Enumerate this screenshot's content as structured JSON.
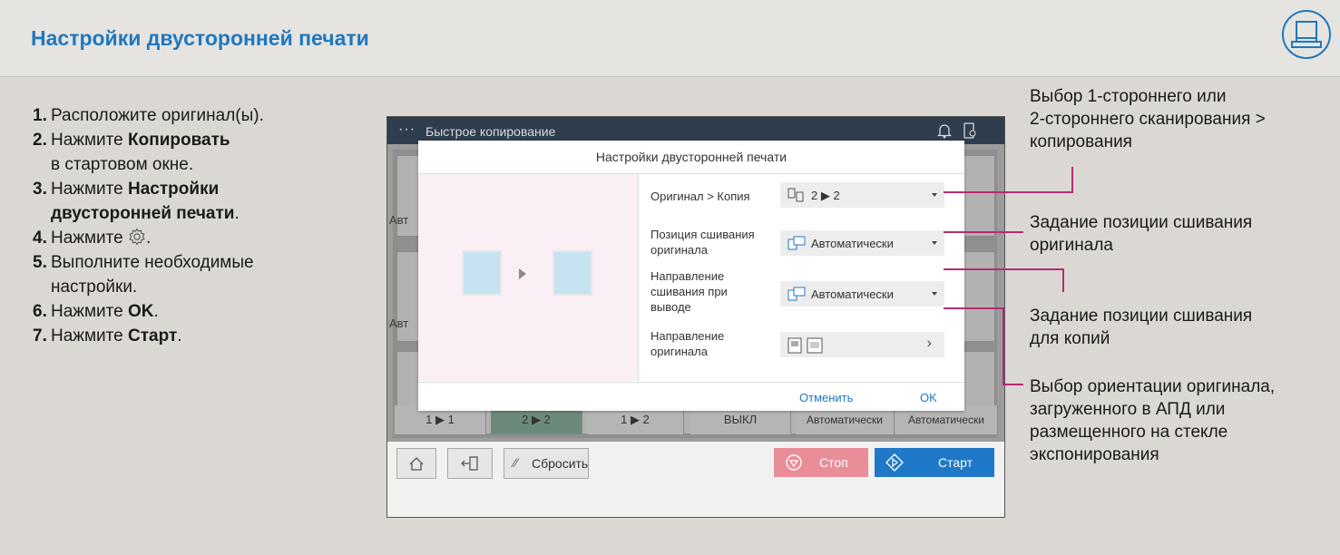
{
  "header": {
    "title": "Настройки двусторонней печати",
    "icon": "copier-device-icon"
  },
  "steps": [
    {
      "num": "1.",
      "text": "Расположите оригинал(ы)."
    },
    {
      "num": "2.",
      "pre": "Нажмите ",
      "bold": "Копировать",
      "line2": "в стартовом окне."
    },
    {
      "num": "3.",
      "pre": "Нажмите ",
      "bold": "Настройки",
      "bold2": "двусторонней печати",
      "post": "."
    },
    {
      "num": "4.",
      "pre": "Нажмите ",
      "post": "."
    },
    {
      "num": "5.",
      "text": "Выполните необходимые",
      "line2": "настройки."
    },
    {
      "num": "6.",
      "pre": "Нажмите ",
      "bold": "OK",
      "post": "."
    },
    {
      "num": "7.",
      "pre": "Нажмите ",
      "bold": "Старт",
      "post": "."
    }
  ],
  "screen": {
    "app_name": "Быстрое копирование",
    "bg_labels": [
      "Авт",
      "Авт"
    ],
    "bg_row": [
      "1 ▶ 1",
      "2 ▶ 2",
      "1 ▶ 2",
      "ВЫКЛ",
      "Автоматически",
      "Автоматически"
    ],
    "dialog": {
      "title": "Настройки двусторонней печати",
      "rows": [
        {
          "label": "Оригинал > Копия",
          "value": "2 ▶ 2"
        },
        {
          "label1": "Позиция сшивания",
          "label2": "оригинала",
          "value": "Автоматически"
        },
        {
          "label1": "Направление",
          "label2": "сшивания при",
          "label3": "выводе",
          "value": "Автоматически"
        },
        {
          "label1": "Направление",
          "label2": "оригинала",
          "chevron": "›"
        }
      ],
      "cancel": "Отменить",
      "ok": "OK"
    },
    "bottom": {
      "reset": "Сбросить",
      "stop": "Стоп",
      "start": "Старт"
    }
  },
  "callouts": {
    "c1": [
      "Выбор 1-стороннего или",
      "2-стороннего сканирования >",
      "копирования"
    ],
    "c2": [
      "Задание позиции сшивания",
      "оригинала"
    ],
    "c3": [
      "Задание позиции сшивания",
      "для копий"
    ],
    "c4": [
      "Выбор ориентации оригинала,",
      "загруженного в АПД или",
      "размещенного на стекле",
      "экспонирования"
    ]
  },
  "colors": {
    "accent": "#1f78bf",
    "callout_line": "#b72a72",
    "stop": "#e98e99",
    "start": "#1f78c8"
  }
}
